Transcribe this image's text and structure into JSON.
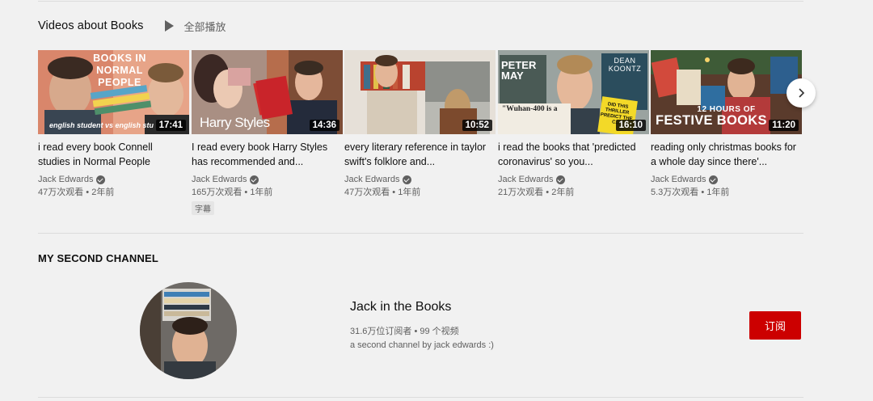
{
  "shelf": {
    "title": "Videos about Books",
    "play_all_label": "全部播放"
  },
  "videos": [
    {
      "title": "i read every book Connell studies in Normal People",
      "duration": "17:41",
      "channel": "Jack Edwards",
      "stats": "47万次观看 • 2年前",
      "thumb_text_top": "BOOKS IN NORMAL PEOPLE",
      "thumb_text_bottom": "english student vs english stu"
    },
    {
      "title": "I read every book Harry Styles has recommended and...",
      "duration": "14:36",
      "channel": "Jack Edwards",
      "stats": "165万次观看 • 1年前",
      "badge": "字幕",
      "thumb_text_bottom": "Harry Styles"
    },
    {
      "title": "every literary reference in taylor swift's folklore and...",
      "duration": "10:52",
      "channel": "Jack Edwards",
      "stats": "47万次观看 • 1年前"
    },
    {
      "title": "i read the books that 'predicted coronavirus' so you...",
      "duration": "16:10",
      "channel": "Jack Edwards",
      "stats": "21万次观看 • 2年前",
      "thumb_text_left": "PETER MAY",
      "thumb_text_right": "DEAN KOONTZ",
      "thumb_quote": "\"Wuhan-400 is a",
      "thumb_yellow": "DID THIS THRILLER PREDICT THE C..."
    },
    {
      "title": "reading only christmas books for a whole day since there'...",
      "duration": "11:20",
      "channel": "Jack Edwards",
      "stats": "5.3万次观看 • 1年前",
      "thumb_text_top": "12 HOURS OF",
      "thumb_text_bottom": "FESTIVE BOOKS"
    }
  ],
  "second_channel": {
    "section_title": "MY SECOND CHANNEL",
    "name": "Jack in the Books",
    "stats": "31.6万位订阅者 • 99 个视频",
    "description": "a second channel by jack edwards :)",
    "subscribe_label": "订阅"
  },
  "colors": {
    "background": "#f1f1f1",
    "subscribe": "#cc0000",
    "secondary_text": "#606060"
  }
}
